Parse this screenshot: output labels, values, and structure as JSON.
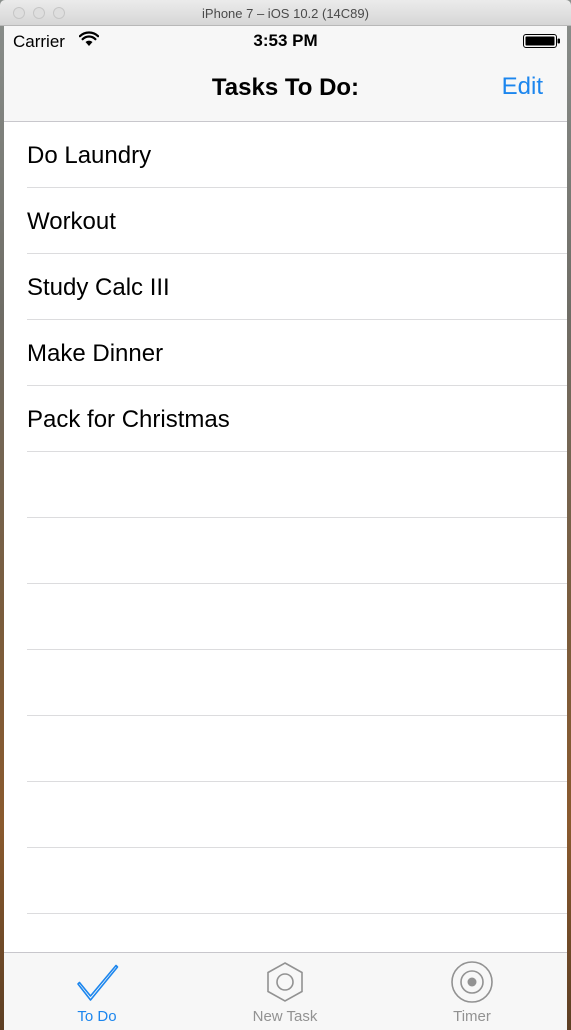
{
  "window": {
    "title": "iPhone 7 – iOS 10.2 (14C89)"
  },
  "status_bar": {
    "carrier": "Carrier",
    "time": "3:53 PM"
  },
  "nav": {
    "title": "Tasks To Do:",
    "edit_label": "Edit"
  },
  "tasks": [
    "Do Laundry",
    "Workout",
    "Study Calc III",
    "Make Dinner",
    "Pack for Christmas"
  ],
  "tabbar": {
    "items": [
      {
        "label": "To Do",
        "icon": "checkmark-icon",
        "active": true
      },
      {
        "label": "New Task",
        "icon": "hexagon-icon",
        "active": false
      },
      {
        "label": "Timer",
        "icon": "target-icon",
        "active": false
      }
    ]
  },
  "colors": {
    "accent": "#1c86ee",
    "inactive": "#929292"
  }
}
